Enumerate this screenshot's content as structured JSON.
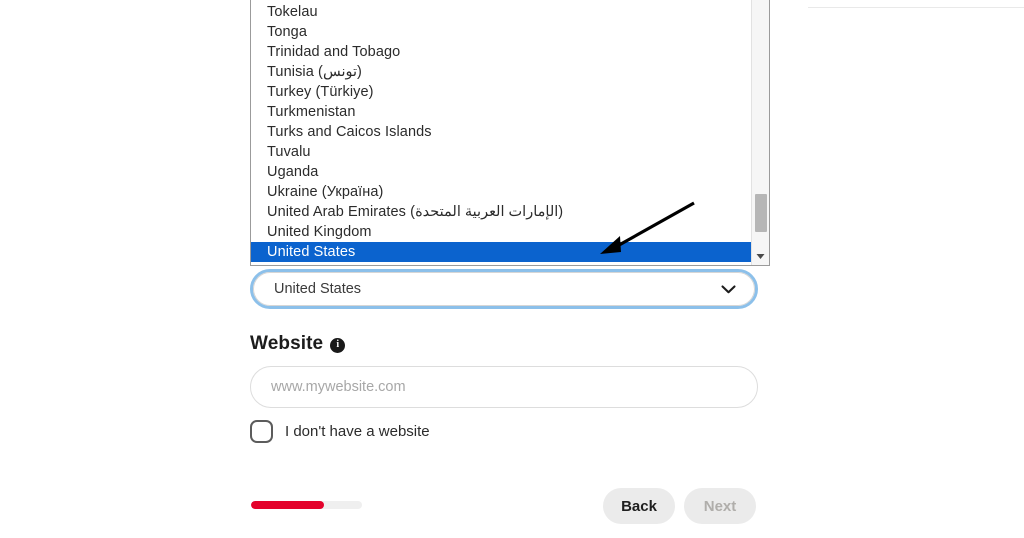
{
  "dropdown": {
    "partial_top_item": "",
    "options": [
      "Tokelau",
      "Tonga",
      "Trinidad and Tobago",
      "Tunisia (تونس)",
      "Turkey (Türkiye)",
      "Turkmenistan",
      "Turks and Caicos Islands",
      "Tuvalu",
      "Uganda",
      "Ukraine (Україна)",
      "United Arab Emirates (الإمارات العربية المتحدة)",
      "United Kingdom",
      "United States"
    ],
    "selected": "United States",
    "selected_index": 12,
    "highlight_color": "#0b63ce",
    "scroll_down_icon": "triangle-down-icon"
  },
  "country_select": {
    "value": "United States",
    "chevron_icon": "chevron-down-icon",
    "focus_ring_color": "#8cc0ea"
  },
  "website": {
    "label": "Website",
    "info_icon": "info-icon",
    "info_glyph": "i",
    "placeholder": "www.mywebsite.com",
    "value": "",
    "no_website_label": "I don't have a website",
    "no_website_checked": false
  },
  "footer": {
    "progress_percent": 66,
    "progress_color": "#e4022b",
    "back_label": "Back",
    "next_label": "Next",
    "next_disabled": true
  },
  "annotation": {
    "arrow_icon": "arrow-pointer-icon",
    "points_to": "United States"
  }
}
